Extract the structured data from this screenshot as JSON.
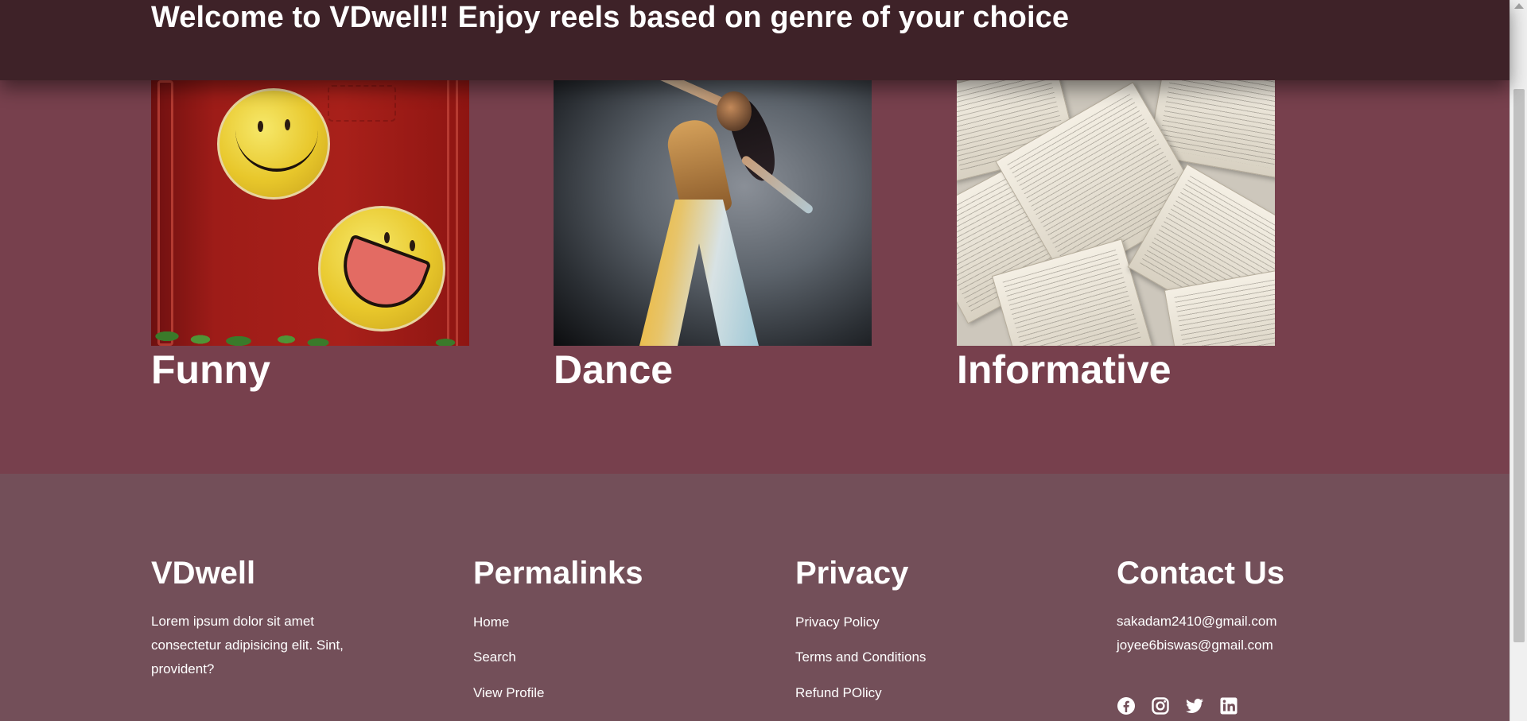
{
  "header": {
    "title": "Welcome to VDwell!! Enjoy reels based on genre of your choice"
  },
  "genres": [
    {
      "label": "Funny",
      "image": "smiley-faces-graffiti"
    },
    {
      "label": "Dance",
      "image": "dancer-photo"
    },
    {
      "label": "Informative",
      "image": "open-books-photo"
    }
  ],
  "footer": {
    "brand": {
      "title": "VDwell",
      "description_lines": [
        "Lorem ipsum dolor sit amet",
        "consectetur adipisicing elit. Sint,",
        "provident?"
      ]
    },
    "permalinks": {
      "title": "Permalinks",
      "links": [
        "Home",
        "Search",
        "View Profile"
      ]
    },
    "privacy": {
      "title": "Privacy",
      "links": [
        "Privacy Policy",
        "Terms and Conditions",
        "Refund POlicy"
      ]
    },
    "contact": {
      "title": "Contact Us",
      "emails": [
        "sakadam2410@gmail.com",
        "joyee6biswas@gmail.com"
      ],
      "social_icons": [
        "facebook-icon",
        "instagram-icon",
        "twitter-icon",
        "linkedin-icon"
      ]
    }
  },
  "colors": {
    "header_bg": "#3e2228",
    "main_bg": "#77404d",
    "footer_bg": "#734f59",
    "text": "#ffffff"
  }
}
